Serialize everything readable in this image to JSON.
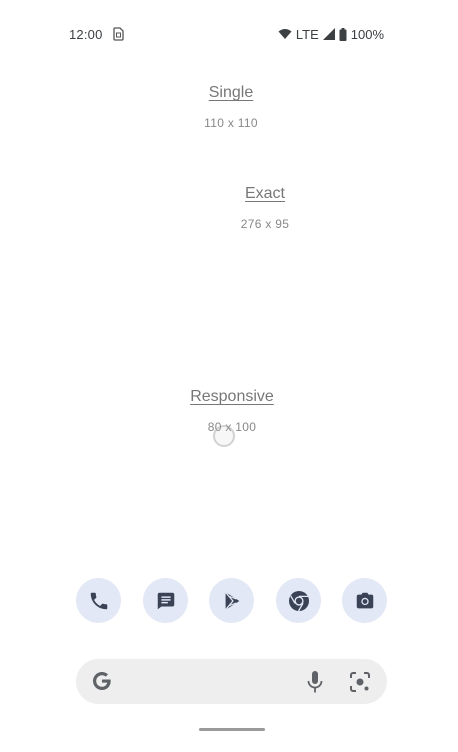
{
  "status_bar": {
    "time": "12:00",
    "network": "LTE",
    "battery": "100%",
    "icons": [
      "sim-card-icon",
      "wifi-icon",
      "signal-icon",
      "battery-icon"
    ]
  },
  "widgets": [
    {
      "title": "Single",
      "size": "110 x 110"
    },
    {
      "title": "Exact",
      "size": "276 x 95"
    },
    {
      "title": "Responsive",
      "size": "80 x 100"
    }
  ],
  "dock": {
    "apps": [
      "phone-icon",
      "messages-icon",
      "play-store-icon",
      "chrome-icon",
      "camera-icon"
    ],
    "accent": "#e3e8f6"
  },
  "search_bar": {
    "icons": [
      "google-g-icon",
      "mic-icon",
      "lens-icon"
    ]
  }
}
